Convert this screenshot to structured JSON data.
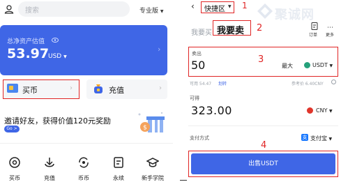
{
  "left": {
    "search": {
      "placeholder": "搜索"
    },
    "pro": {
      "label": "专业版"
    },
    "asset": {
      "label": "总净资产估值",
      "value": "53.97",
      "unit": "USD"
    },
    "tiles": {
      "buy": "买币",
      "deposit": "充值"
    },
    "promo": {
      "text": "邀请好友，获得价值120元奖励",
      "go": "Go >"
    },
    "nav": [
      {
        "label": "买币",
        "icon": "buy-coin-icon"
      },
      {
        "label": "充值",
        "icon": "deposit-arrow-icon"
      },
      {
        "label": "币币",
        "icon": "swap-coin-icon"
      },
      {
        "label": "永续",
        "icon": "perpetual-doc-icon"
      },
      {
        "label": "新手学院",
        "icon": "graduation-cap-icon"
      }
    ]
  },
  "right": {
    "header": {
      "quick_zone": "快捷区"
    },
    "watermark": {
      "text": "聚诚网"
    },
    "tabs": {
      "buy": "我要买",
      "sell": "我要卖"
    },
    "actions": {
      "orders": "订单",
      "more": "更多"
    },
    "sell_field": {
      "label": "卖出",
      "amount": "50",
      "max": "最大",
      "currency": "USDT"
    },
    "balance": {
      "available": "可用 54.47",
      "transfer": "划转",
      "ref_price": "参考价 6.40CNY"
    },
    "receive": {
      "label": "可得",
      "amount": "323.00",
      "currency": "CNY"
    },
    "payment": {
      "label": "支付方式",
      "method": "支付宝"
    },
    "submit": {
      "label": "出售USDT"
    }
  },
  "annotations": {
    "n1": "1",
    "n2": "2",
    "n3": "3",
    "n4": "4"
  },
  "colors": {
    "primary": "#3f66e6",
    "highlight": "#e02424",
    "usdt": "#26a17b",
    "cny": "#e0352b",
    "alipay": "#1677ff"
  }
}
